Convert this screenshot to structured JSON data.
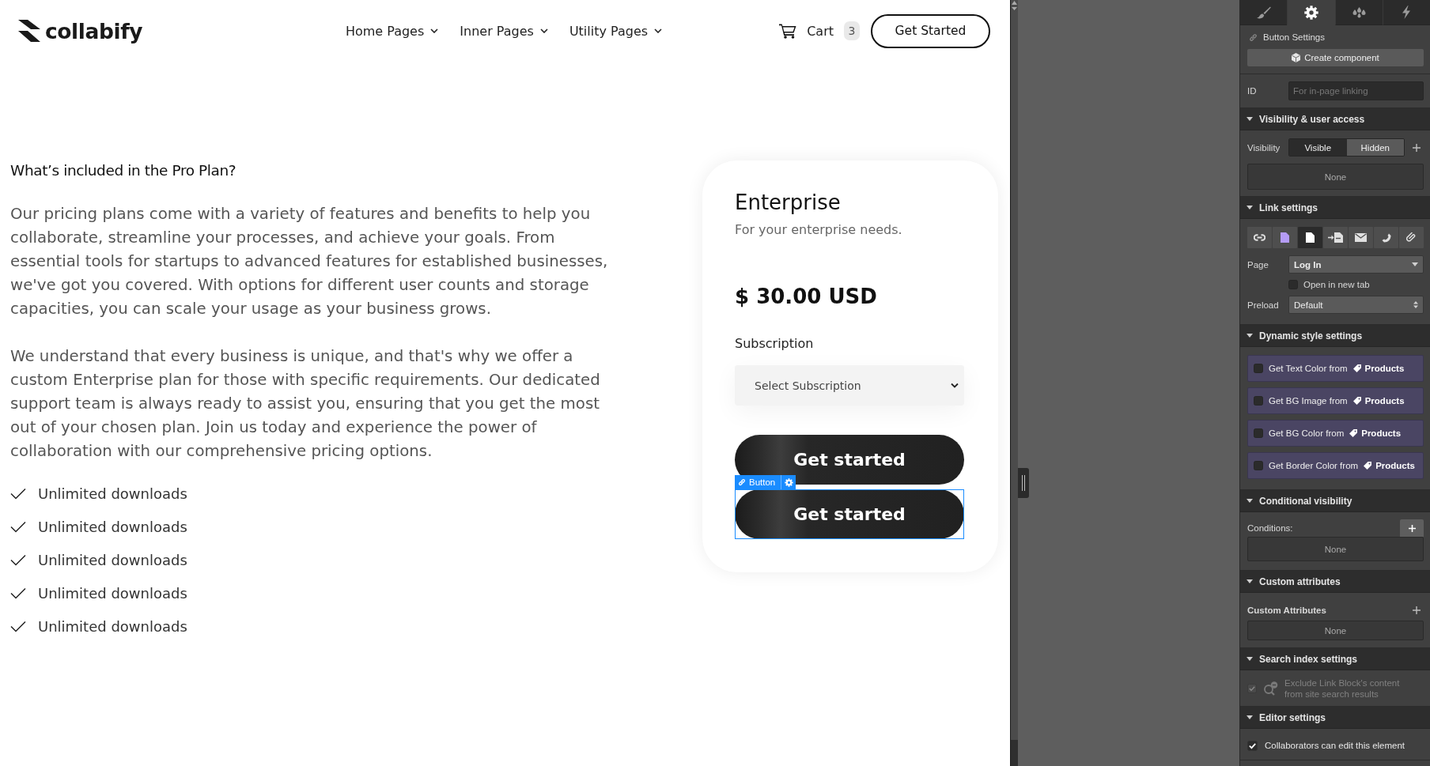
{
  "site_nav": {
    "logo": "collabify",
    "links": [
      {
        "label": "Home Pages"
      },
      {
        "label": "Inner Pages"
      },
      {
        "label": "Utility Pages"
      }
    ],
    "cart": {
      "label": "Cart",
      "count": "3"
    },
    "cta": "Get Started"
  },
  "intro": {
    "heading": "What’s included in the Pro Plan?",
    "paragraphs": [
      "Our pricing plans come with a variety of features and benefits to help you collaborate, streamline your processes, and achieve your goals. From essential tools for startups to advanced features for established businesses, we've got you covered. With options for different user counts and storage capacities, you can scale your usage as your business grows.",
      "We understand that every business is unique, and that's why we offer a custom Enterprise plan for those with specific requirements. Our dedicated support team is always ready to assist you, ensuring that you get the most out of your chosen plan. Join us today and experience the power of collaboration with our comprehensive pricing options."
    ],
    "features": [
      "Unlimited downloads",
      "Unlimited downloads",
      "Unlimited downloads",
      "Unlimited downloads",
      "Unlimited downloads"
    ]
  },
  "pricing_card": {
    "title": "Enterprise",
    "subtitle": "For your enterprise needs.",
    "price": "$ 30.00 USD",
    "subscription": {
      "label": "Subscription",
      "value": "Select Subscription"
    },
    "buttons": [
      {
        "label": "Get started",
        "selected": false
      },
      {
        "label": "Get started",
        "selected": true
      }
    ],
    "selection_tag": "Button"
  },
  "settings_panel": {
    "tabs": [
      {
        "selected": false
      },
      {
        "selected": true
      },
      {
        "selected": false
      },
      {
        "selected": false
      }
    ],
    "title": "Button Settings",
    "create_component": "Create component",
    "id_field": {
      "label": "ID",
      "placeholder": "For in-page linking"
    },
    "sections": [
      {
        "kind": "visibility",
        "title": "Visibility & user access",
        "expanded": true,
        "label": "Visibility",
        "options": [
          {
            "label": "Visible",
            "selected": true
          },
          {
            "label": "Hidden",
            "selected": false
          }
        ],
        "empty": "None"
      },
      {
        "kind": "link",
        "title": "Link settings",
        "expanded": true,
        "link_types": [
          {
            "selected": false
          },
          {
            "selected": false
          },
          {
            "selected": true
          },
          {
            "selected": false
          },
          {
            "selected": false
          },
          {
            "selected": false
          },
          {
            "selected": false
          }
        ],
        "page": {
          "label": "Page",
          "value": "Log In"
        },
        "new_tab": {
          "label": "Open in new tab",
          "checked": false
        },
        "preload": {
          "label": "Preload",
          "value": "Default"
        }
      },
      {
        "kind": "dynamic",
        "title": "Dynamic style settings",
        "expanded": true,
        "bindings": [
          {
            "label": "Get Text Color from",
            "source": "Products",
            "checked": false
          },
          {
            "label": "Get BG Image from",
            "source": "Products",
            "checked": false
          },
          {
            "label": "Get BG Color from",
            "source": "Products",
            "checked": false
          },
          {
            "label": "Get Border Color from",
            "source": "Products",
            "checked": false
          }
        ]
      },
      {
        "kind": "conditional",
        "title": "Conditional visibility",
        "expanded": true,
        "label": "Conditions:",
        "empty": "None"
      },
      {
        "kind": "attributes",
        "title": "Custom attributes",
        "expanded": true,
        "label": "Custom Attributes",
        "empty": "None"
      },
      {
        "kind": "search_index",
        "title": "Search index settings",
        "expanded": true,
        "option": {
          "label": "Exclude Link Block's content from site search results",
          "checked": true,
          "disabled": true
        }
      },
      {
        "kind": "editor",
        "title": "Editor settings",
        "expanded": true,
        "option": {
          "label": "Collaborators can edit this element",
          "checked": true
        }
      }
    ]
  }
}
